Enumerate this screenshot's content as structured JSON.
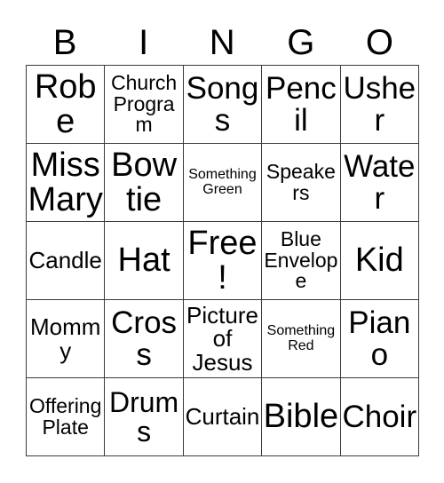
{
  "card": {
    "title": "BINGO",
    "header_letters": [
      "B",
      "I",
      "N",
      "G",
      "O"
    ],
    "grid_size": "5x5",
    "free_space": "Free!",
    "colors": {
      "background": "#ffffff",
      "text": "#000000",
      "border": "#3a3a3a"
    },
    "rows": [
      [
        {
          "label": "Robe",
          "size": "xxl"
        },
        {
          "label": "Church\nProgram",
          "size": "sm"
        },
        {
          "label": "Songs",
          "size": "xl"
        },
        {
          "label": "Pencil",
          "size": "xl"
        },
        {
          "label": "Usher",
          "size": "xl"
        }
      ],
      [
        {
          "label": "Miss\nMary",
          "size": "xxl"
        },
        {
          "label": "Bow\ntie",
          "size": "xxl"
        },
        {
          "label": "Something\nGreen",
          "size": "xs"
        },
        {
          "label": "Speakers",
          "size": "sm"
        },
        {
          "label": "Water",
          "size": "xl"
        }
      ],
      [
        {
          "label": "Candle",
          "size": "md"
        },
        {
          "label": "Hat",
          "size": "xxl"
        },
        {
          "label": "Free!",
          "size": "xxl"
        },
        {
          "label": "Blue\nEnvelope",
          "size": "sm"
        },
        {
          "label": "Kid",
          "size": "xxl"
        }
      ],
      [
        {
          "label": "Mommy",
          "size": "md"
        },
        {
          "label": "Cross",
          "size": "xl"
        },
        {
          "label": "Picture\nof\nJesus",
          "size": "md"
        },
        {
          "label": "Something\nRed",
          "size": "xs"
        },
        {
          "label": "Piano",
          "size": "xl"
        }
      ],
      [
        {
          "label": "Offering\nPlate",
          "size": "sm"
        },
        {
          "label": "Drums",
          "size": "lg"
        },
        {
          "label": "Curtain",
          "size": "md"
        },
        {
          "label": "Bible",
          "size": "xxl"
        },
        {
          "label": "Choir",
          "size": "xl"
        }
      ]
    ]
  }
}
